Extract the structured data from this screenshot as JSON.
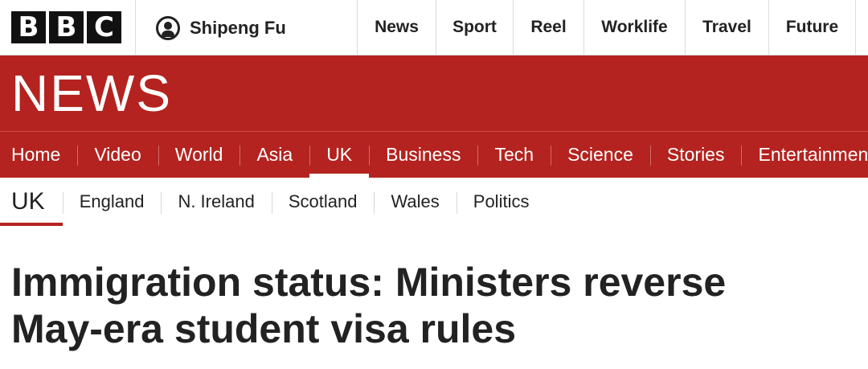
{
  "bbc_logo": [
    "B",
    "B",
    "C"
  ],
  "account": {
    "name": "Shipeng Fu",
    "icon": "user-icon"
  },
  "top_nav": [
    "News",
    "Sport",
    "Reel",
    "Worklife",
    "Travel",
    "Future"
  ],
  "brand": "NEWS",
  "main_nav": [
    "Home",
    "Video",
    "World",
    "Asia",
    "UK",
    "Business",
    "Tech",
    "Science",
    "Stories",
    "Entertainment"
  ],
  "main_nav_active": "UK",
  "sub_nav": {
    "section": "UK",
    "items": [
      "England",
      "N. Ireland",
      "Scotland",
      "Wales",
      "Politics"
    ]
  },
  "headline": {
    "line1": "Immigration status: Ministers reverse",
    "line2": "May-era student visa rules"
  },
  "colors": {
    "brand_red": "#b4231f",
    "text": "#222222"
  }
}
